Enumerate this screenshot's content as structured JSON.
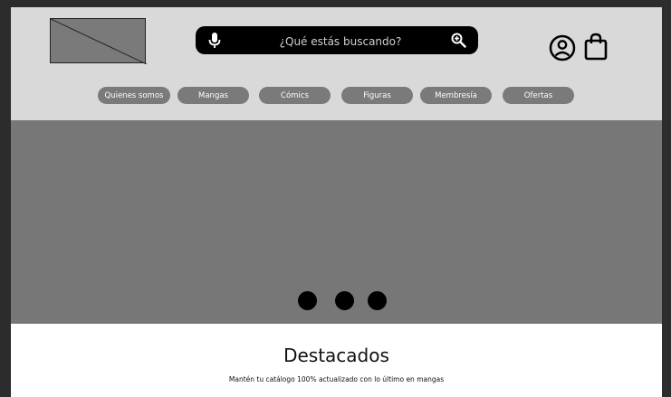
{
  "header": {
    "search": {
      "placeholder": "¿Qué estás buscando?",
      "mic_icon": "microphone-icon",
      "zoom_icon": "zoom-in-icon"
    },
    "account_icon": "user-circle-icon",
    "cart_icon": "shopping-bag-icon"
  },
  "nav": {
    "items": [
      "Quienes somos",
      "Mangas",
      "Cómics",
      "Figuras",
      "Membresía",
      "Ofertas"
    ]
  },
  "hero": {
    "carousel_slides": 3
  },
  "featured": {
    "title": "Destacados",
    "subtitle": "Mantén tu catálogo 100% actualizado con lo último en mangas"
  },
  "colors": {
    "header_bg": "#d9d9d9",
    "hero_bg": "#777777",
    "pill_bg": "#7a7a7a",
    "search_bg": "#000000",
    "outer_bg": "#2c2c2c"
  }
}
